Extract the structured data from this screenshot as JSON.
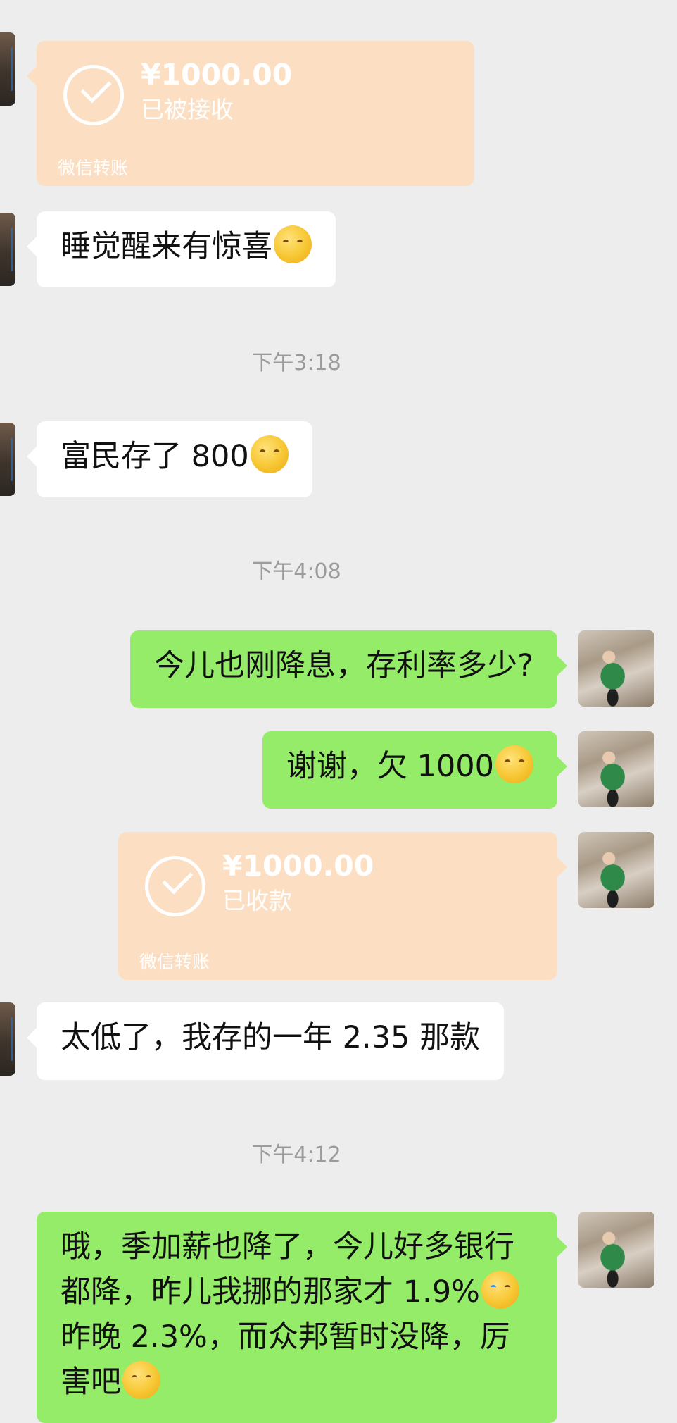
{
  "messages": [
    {
      "id": "m1",
      "type": "transfer",
      "side": "left",
      "amount": "¥1000.00",
      "status": "已被接收",
      "footer": "微信转账"
    },
    {
      "id": "m2",
      "type": "text",
      "side": "left",
      "text": "睡觉醒来有惊喜",
      "emoji": "face-with-hand-over-mouth"
    },
    {
      "id": "t1",
      "type": "time",
      "text": "下午3:18"
    },
    {
      "id": "m3",
      "type": "text",
      "side": "left",
      "text": "富民存了 800",
      "emoji": "face-with-hand-over-mouth"
    },
    {
      "id": "t2",
      "type": "time",
      "text": "下午4:08"
    },
    {
      "id": "m4",
      "type": "text",
      "side": "right",
      "text": "今儿也刚降息，存利率多少?"
    },
    {
      "id": "m5",
      "type": "text",
      "side": "right",
      "text": "谢谢，欠 1000",
      "emoji": "kissing-face"
    },
    {
      "id": "m6",
      "type": "transfer",
      "side": "right",
      "amount": "¥1000.00",
      "status": "已收款",
      "footer": "微信转账"
    },
    {
      "id": "m7",
      "type": "text",
      "side": "left",
      "text": "太低了，我存的一年 2.35 那款"
    },
    {
      "id": "t3",
      "type": "time",
      "text": "下午4:12"
    },
    {
      "id": "m8",
      "type": "text",
      "side": "right",
      "lines": [
        "哦，季加薪也降了，今儿好多银行",
        "都降，昨儿我挪的那家才 1.9%",
        "昨晚 2.3%，而众邦暂时没降，厉",
        "害吧"
      ],
      "emoji_line2": "loudly-crying-face",
      "emoji_line4": "grinning-face"
    }
  ],
  "colors": {
    "background": "#ededed",
    "bubble_self": "#95ec69",
    "bubble_other": "#ffffff",
    "transfer": "#fcdfc3",
    "timestamp": "#9b9b9b"
  }
}
